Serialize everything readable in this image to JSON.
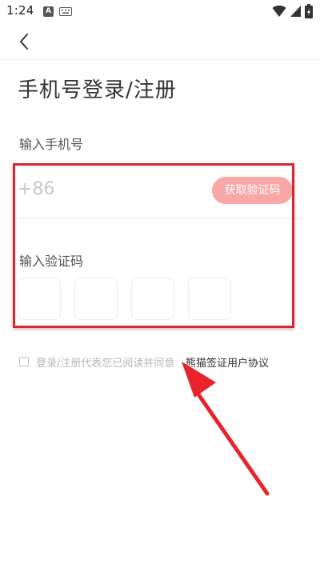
{
  "status_bar": {
    "time": "1:24",
    "notification_icon_letter": "A"
  },
  "header": {
    "back_icon": "chevron-left-icon"
  },
  "title": "手机号登录/注册",
  "phone": {
    "label": "输入手机号",
    "prefix": "+86",
    "get_code_button": "获取验证码"
  },
  "code": {
    "label": "输入验证码",
    "box_count": 4
  },
  "agreement": {
    "text": "登录/注册代表您已阅读并同意",
    "link": "熊猫签证用户协议"
  },
  "colors": {
    "accent": "#f9a7a7",
    "annotation": "#e8232b"
  }
}
